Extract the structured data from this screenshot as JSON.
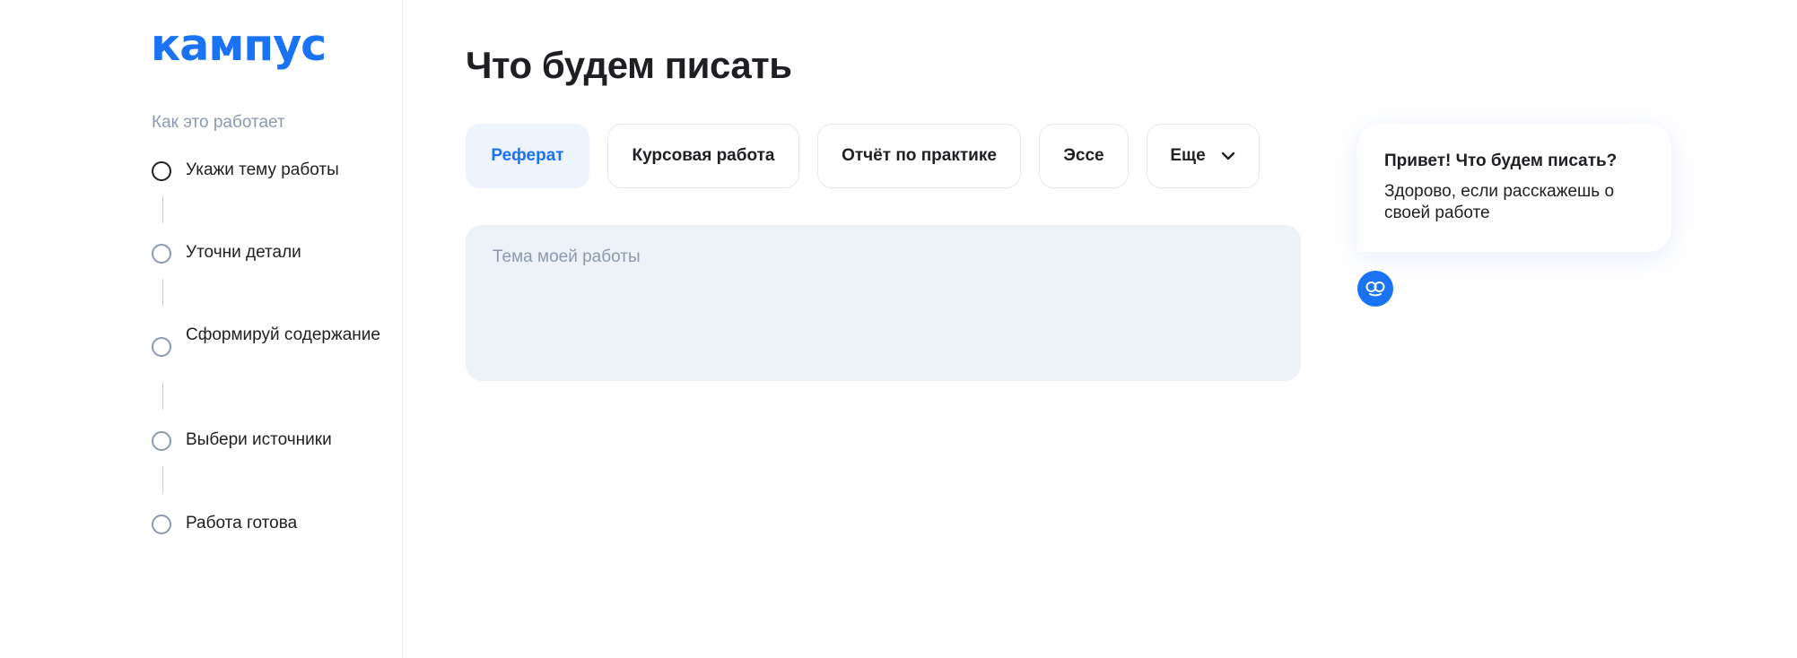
{
  "brand": {
    "logo_text": "кампус",
    "accent_color": "#1a73f5"
  },
  "sidebar": {
    "how_title": "Как это работает",
    "steps": [
      {
        "label": "Укажи тему работы",
        "state": "active"
      },
      {
        "label": "Уточни детали",
        "state": "idle"
      },
      {
        "label": "Сформируй содержание",
        "state": "idle"
      },
      {
        "label": "Выбери источники",
        "state": "idle"
      },
      {
        "label": "Работа готова",
        "state": "idle"
      }
    ]
  },
  "main": {
    "title": "Что будем писать",
    "tabs": [
      {
        "label": "Реферат",
        "selected": true
      },
      {
        "label": "Курсовая работа",
        "selected": false
      },
      {
        "label": "Отчёт по практике",
        "selected": false
      },
      {
        "label": "Эссе",
        "selected": false
      },
      {
        "label": "Еще",
        "selected": false,
        "icon": "chevron-down-icon"
      }
    ],
    "topic_input": {
      "placeholder": "Тема моей работы",
      "value": ""
    }
  },
  "assistant": {
    "title": "Привет! Что будем писать?",
    "text": "Здорово, если расскажешь о своей работе",
    "avatar_icon": "assistant-face-icon"
  }
}
